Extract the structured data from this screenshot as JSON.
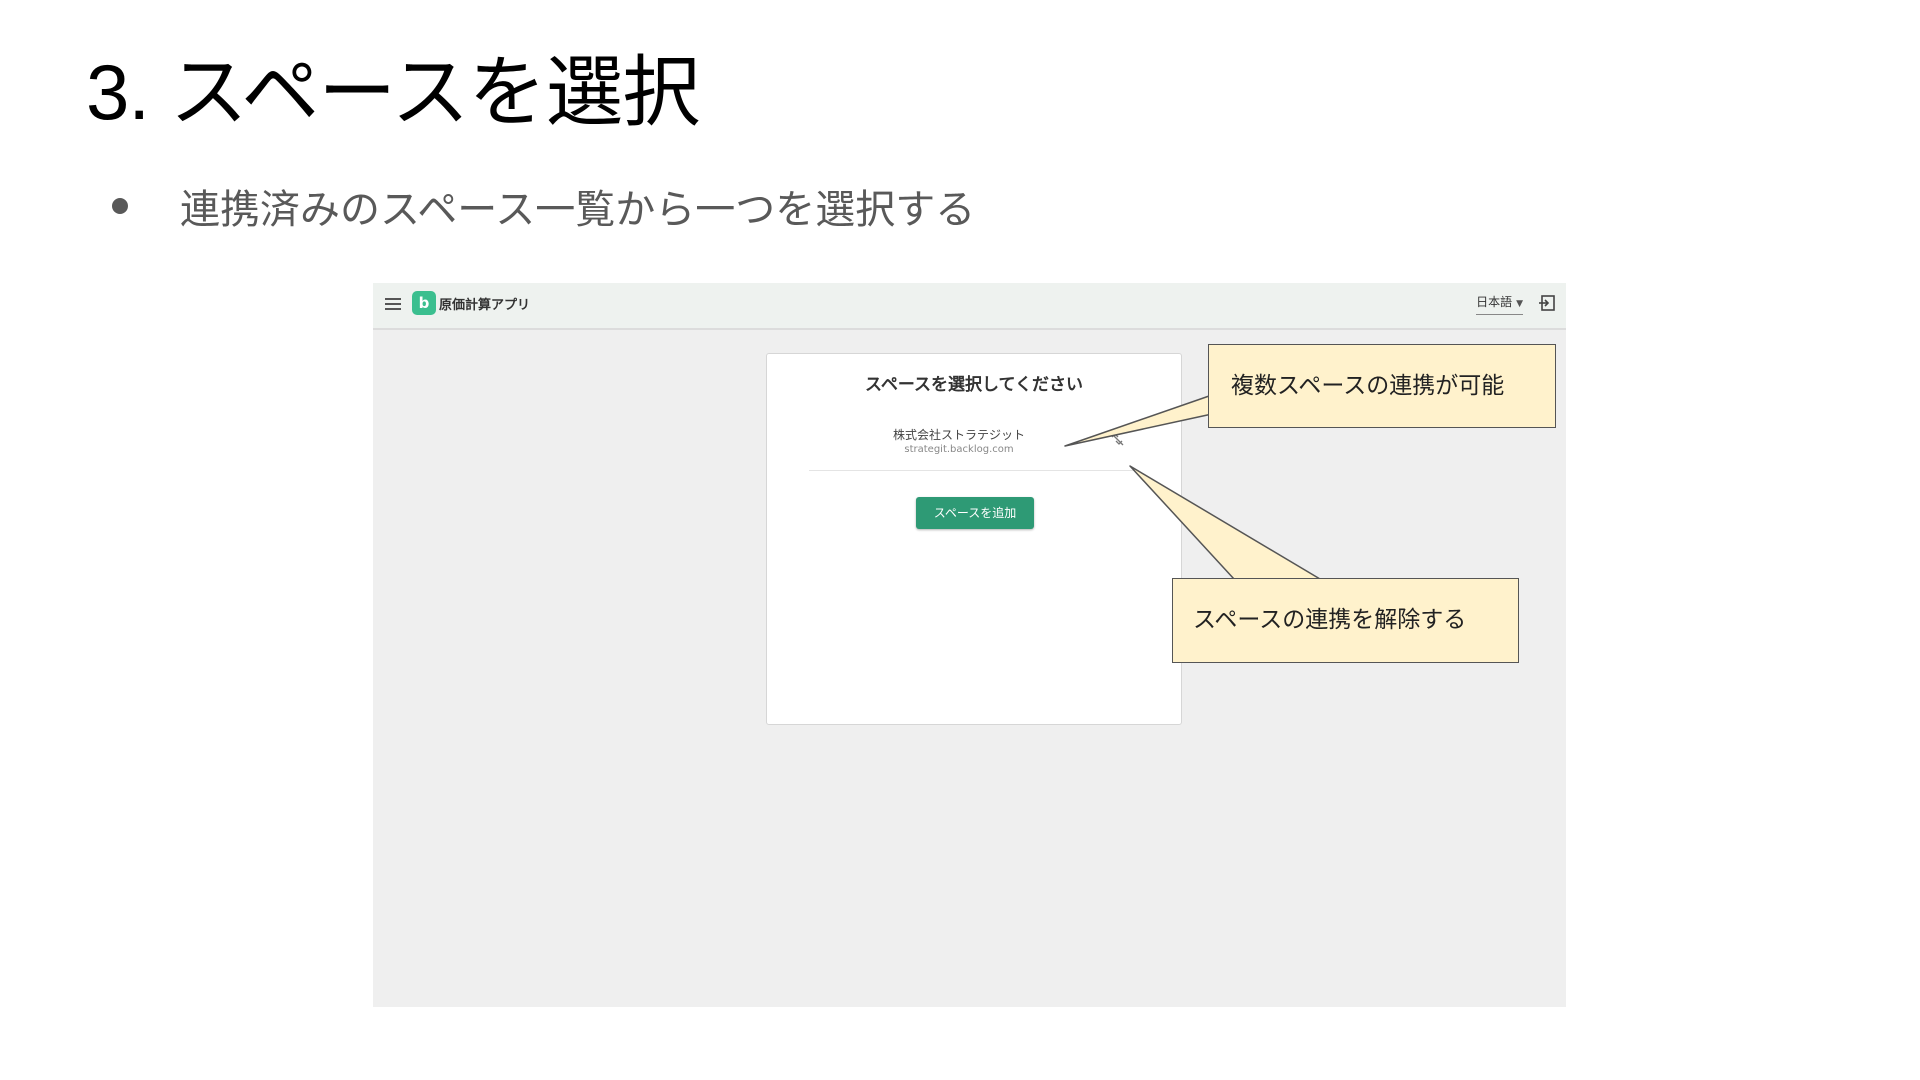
{
  "slide": {
    "title": "3. スペースを選択",
    "bullet": "連携済みのスペース一覧から一つを選択する"
  },
  "app": {
    "name": "原価計算アプリ",
    "logo_letter": "b",
    "language": "日本語",
    "card": {
      "title": "スペースを選択してください",
      "spaces": [
        {
          "name": "株式会社ストラテジット",
          "url": "strategit.backlog.com"
        }
      ],
      "add_button": "スペースを追加"
    }
  },
  "callouts": {
    "multi_space": "複数スペースの連携が可能",
    "unlink": "スペースの連携を解除する"
  },
  "colors": {
    "accent_green": "#2e9a75",
    "logo_green": "#3bbf8f",
    "callout_fill": "#fff2cc",
    "header_bg": "#eef2ef"
  },
  "icons": [
    "menu-icon",
    "logo-icon",
    "logout-icon",
    "unlink-icon",
    "bullet-dot"
  ]
}
